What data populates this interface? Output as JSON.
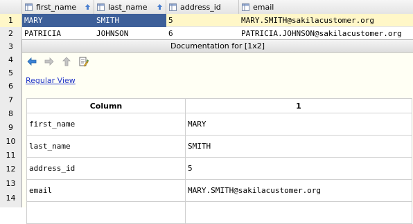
{
  "grid": {
    "columns": [
      {
        "label": "first_name",
        "icon": "table-column-icon"
      },
      {
        "label": "last_name",
        "icon": "table-column-icon"
      },
      {
        "label": "address_id",
        "icon": "table-column-icon"
      },
      {
        "label": "email",
        "icon": "table-column-icon"
      }
    ],
    "row_numbers": [
      "1",
      "2",
      "3",
      "4",
      "5",
      "6",
      "7",
      "8",
      "9",
      "10",
      "11",
      "12",
      "13",
      "14"
    ],
    "rows": [
      [
        "MARY",
        "SMITH",
        "5",
        "MARY.SMITH@sakilacustomer.org"
      ],
      [
        "PATRICIA",
        "JOHNSON",
        "6",
        "PATRICIA.JOHNSON@sakilacustomer.org"
      ]
    ]
  },
  "doc": {
    "title": "Documentation for [1x2]",
    "toolbar": [
      {
        "name": "back-icon",
        "color": "#2a73c9"
      },
      {
        "name": "forward-icon",
        "color": "#aaaaaa"
      },
      {
        "name": "up-icon",
        "color": "#aaaaaa"
      },
      {
        "name": "edit-source-icon",
        "color": "#4a7a3a"
      }
    ],
    "view_link": "Regular View",
    "table": {
      "headers": [
        "Column",
        "1"
      ],
      "rows": [
        [
          "first_name",
          "MARY"
        ],
        [
          "last_name",
          "SMITH"
        ],
        [
          "address_id",
          "5"
        ],
        [
          "email",
          "MARY.SMITH@sakilacustomer.org"
        ],
        [
          "",
          ""
        ]
      ]
    }
  },
  "colors": {
    "selection": "#3d5f99",
    "current_row": "#fff7c8",
    "link": "#2034c8"
  }
}
